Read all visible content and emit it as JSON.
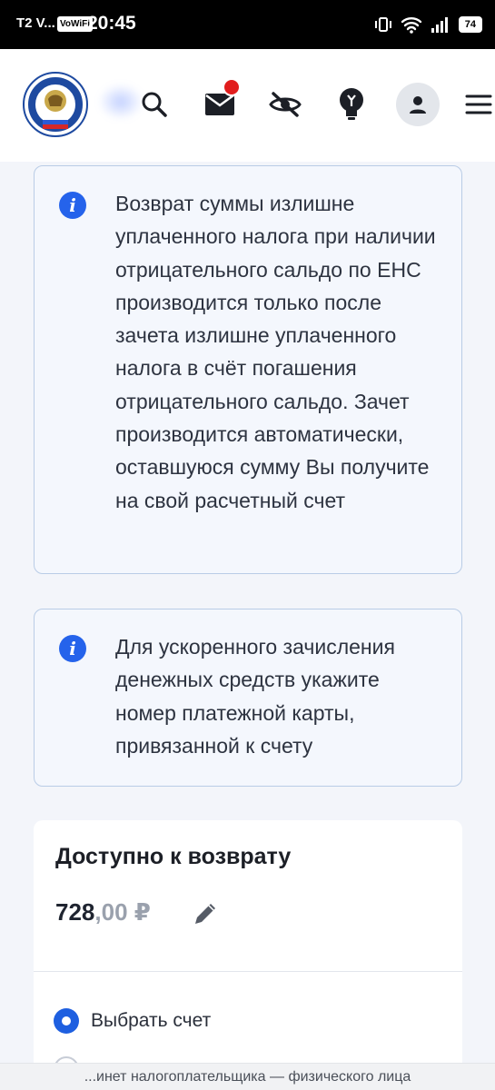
{
  "status_bar": {
    "carrier": "T2 V...",
    "vowifi": "VoWiFi",
    "time": "20:45",
    "battery": "74"
  },
  "header": {
    "logo_icon": "fns-emblem-logo",
    "icons": [
      "search-icon",
      "mail-icon",
      "hide-eye-icon",
      "lightbulb-icon",
      "user-icon",
      "menu-icon"
    ],
    "notification_color": "#e11d1d"
  },
  "info_cards": [
    {
      "text": "Возврат суммы излишне уплаченного налога при наличии отрицательного сальдо по ЕНС производится только после зачета излишне уплаченного налога в счёт погашения отрицательного сальдо. Зачет производится автоматически, оставшуюся сумму Вы получите на свой расчетный счет"
    },
    {
      "text": "Для ускоренного зачисления денежных средств укажите номер платежной карты, привязанной к счету"
    }
  ],
  "refund": {
    "title": "Доступно к возврату",
    "amount_int": "728",
    "amount_dec": ",00 ₽",
    "option_selected": "Выбрать счет"
  },
  "bottom_url": "...инет налогоплательщика — физического лица",
  "colors": {
    "accent": "#2563eb",
    "card_border": "#b9cce6"
  }
}
